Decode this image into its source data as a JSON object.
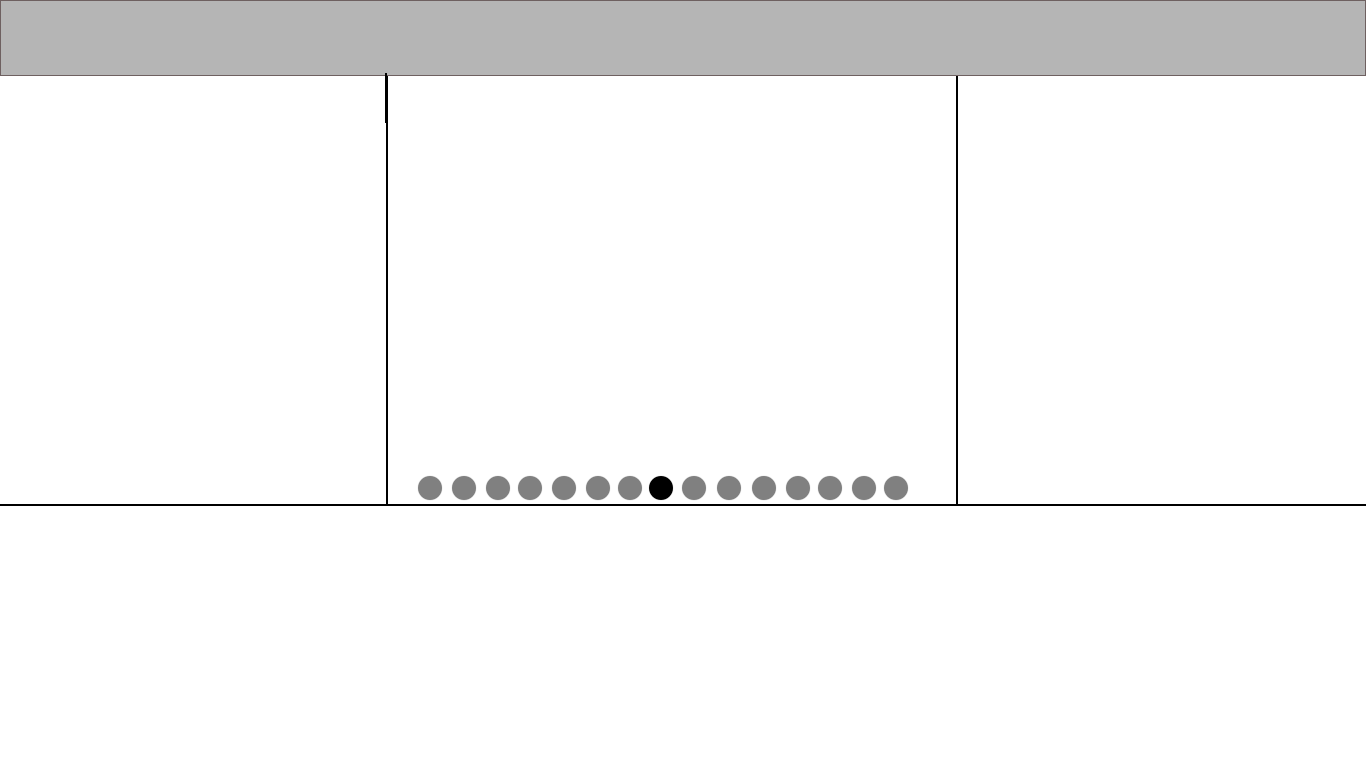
{
  "header": {
    "background_color": "#b5b5b5"
  },
  "carousel": {
    "total_slides": 15,
    "active_index": 7,
    "inactive_color": "#808080",
    "active_color": "#000000"
  }
}
